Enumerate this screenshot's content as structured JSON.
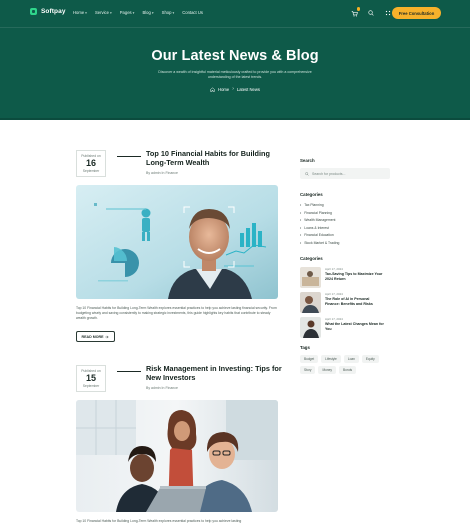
{
  "brand": {
    "name": "Softpay",
    "accent": "#f6b12b",
    "hero_bg": "#0e5a49"
  },
  "nav": {
    "items": [
      {
        "label": "Home",
        "has_dropdown": true
      },
      {
        "label": "Service",
        "has_dropdown": true
      },
      {
        "label": "Pages",
        "has_dropdown": true
      },
      {
        "label": "Blog",
        "has_dropdown": true
      },
      {
        "label": "Shop",
        "has_dropdown": true
      },
      {
        "label": "Contact Us",
        "has_dropdown": false
      }
    ],
    "icons": [
      "cart-icon",
      "search-icon",
      "menu-grid-icon"
    ],
    "cta_label": "Free Consultation"
  },
  "hero": {
    "title": "Our Latest News & Blog",
    "subtitle": "Discover a wealth of insightful material meticulously crafted to provide you with a comprehensive understanding of the latest trends.",
    "breadcrumb": {
      "home": "Home",
      "current": "Latest News"
    }
  },
  "posts": [
    {
      "published_label": "Published on",
      "day": "16",
      "month": "September",
      "title": "Top 10 Financial Habits for Building Long-Term Wealth",
      "meta": "By admin  In Finance",
      "excerpt": "Top 10 Financial Habits for Building Long-Term Wealth explores essential practices to help you achieve lasting financial security. From budgeting wisely and saving consistently to making strategic investments, this guide highlights key habits that contribute to steady wealth growth.",
      "read_more": "READ MORE"
    },
    {
      "published_label": "Published on",
      "day": "15",
      "month": "September",
      "title": "Risk Management in Investing: Tips for New Investors",
      "meta": "By admin  In Finance",
      "excerpt": "Top 10 Financial Habits for Building Long-Term Wealth explores essential practices to help you achieve lasting"
    }
  ],
  "sidebar": {
    "search": {
      "heading": "Search",
      "placeholder": "Search for products..."
    },
    "categories": {
      "heading": "Categories",
      "items": [
        "Tax Planning",
        "Financial Planning",
        "Wealth Management",
        "Loans & Interest",
        "Financial Education",
        "Stock Market & Trading"
      ]
    },
    "recent": {
      "heading": "Categories",
      "items": [
        {
          "date": "April 17, 2024",
          "title": "Tax-Saving Tips to Maximize Your 2024 Return"
        },
        {
          "date": "April 17, 2024",
          "title": "The Role of AI in Personal Finance: Benefits and Risks"
        },
        {
          "date": "April 17, 2024",
          "title": "What the Latest Changes Mean for You"
        }
      ]
    },
    "tags": {
      "heading": "Tags",
      "items": [
        "Budget",
        "Lifestyle",
        "Loan",
        "Equity",
        "Story",
        "Money",
        "Bonds"
      ]
    }
  }
}
